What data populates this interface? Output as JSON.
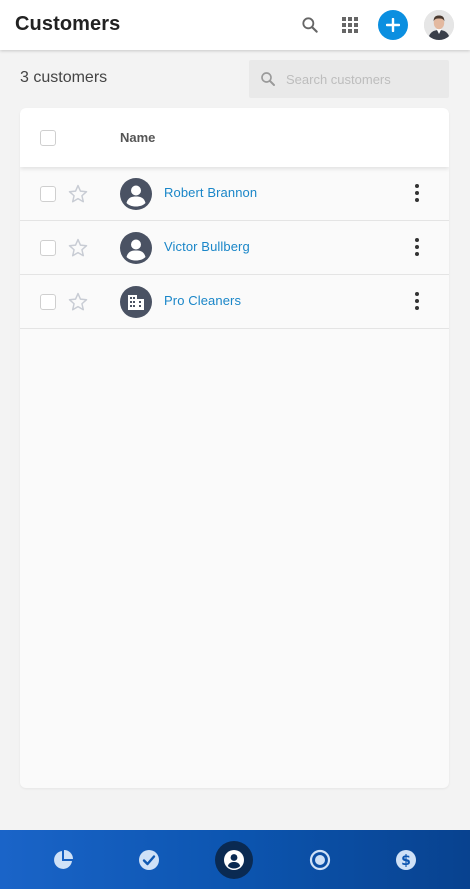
{
  "header": {
    "title": "Customers"
  },
  "summary": {
    "count_label": "3 customers"
  },
  "search": {
    "placeholder": "Search customers",
    "value": ""
  },
  "table": {
    "columns": [
      "Name"
    ],
    "rows": [
      {
        "name": "Robert Brannon",
        "type": "person",
        "starred": false
      },
      {
        "name": "Victor Bullberg",
        "type": "person",
        "starred": false
      },
      {
        "name": "Pro Cleaners",
        "type": "company",
        "starred": false
      }
    ]
  },
  "bottom_nav": {
    "items": [
      {
        "icon": "dashboard-pie-icon",
        "active": false
      },
      {
        "icon": "tasks-check-icon",
        "active": false
      },
      {
        "icon": "customers-person-icon",
        "active": true
      },
      {
        "icon": "target-circle-icon",
        "active": false
      },
      {
        "icon": "dollar-icon",
        "active": false
      }
    ]
  },
  "colors": {
    "accent": "#0b8fe0",
    "link": "#1a86c8",
    "nav_gradient_start": "#1a64c8",
    "nav_gradient_end": "#08428f",
    "nav_active": "#0a2a52",
    "avatar_bg": "#4a5263"
  }
}
